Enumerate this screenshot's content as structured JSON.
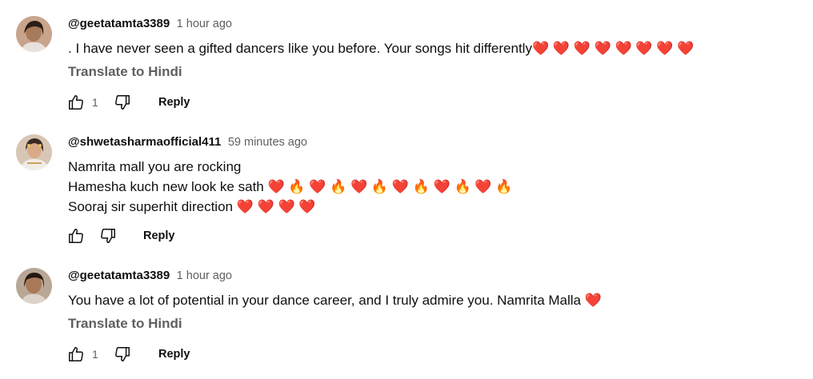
{
  "comments": [
    {
      "author": "@geetatamta3389",
      "time": "1 hour ago",
      "lines": [
        ". I have never seen a gifted dancers  like you before. Your songs hit differently❤️ ❤️ ❤️ ❤️ ❤️ ❤️ ❤️ ❤️"
      ],
      "translate": "Translate to Hindi",
      "likes": "1",
      "reply": "Reply"
    },
    {
      "author": "@shwetasharmaofficial411",
      "time": "59 minutes ago",
      "lines": [
        "Namrita mall you are rocking",
        "Hamesha kuch new look ke sath ❤️ 🔥 ❤️ 🔥 ❤️ 🔥 ❤️ 🔥 ❤️ 🔥 ❤️ 🔥",
        "Sooraj sir superhit direction ❤️ ❤️ ❤️ ❤️"
      ],
      "reply": "Reply"
    },
    {
      "author": "@geetatamta3389",
      "time": "1 hour ago",
      "lines": [
        "You have a lot of potential in your dance  career, and I truly admire you. Namrita Malla ❤️"
      ],
      "translate": "Translate to Hindi",
      "likes": "1",
      "reply": "Reply"
    }
  ],
  "icons": {
    "like": "thumbs-up-icon",
    "dislike": "thumbs-down-icon"
  },
  "colors": {
    "text_primary": "#0f0f0f",
    "text_secondary": "#606060",
    "background": "#ffffff"
  }
}
